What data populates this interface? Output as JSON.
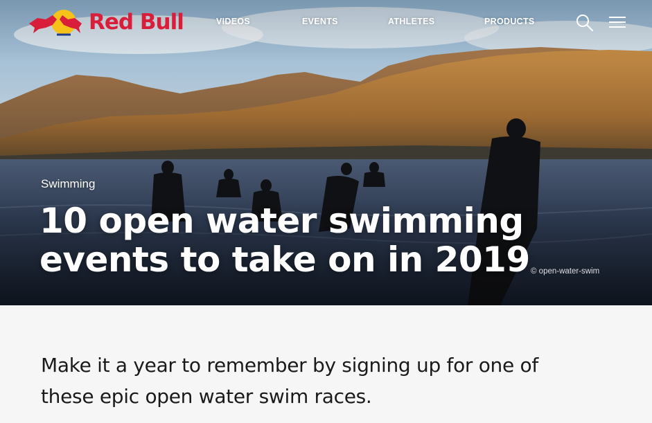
{
  "brand": {
    "name": "Red Bull",
    "color": "#d81e3a"
  },
  "nav": {
    "items": [
      {
        "label": "VIDEOS"
      },
      {
        "label": "EVENTS"
      },
      {
        "label": "ATHLETES"
      },
      {
        "label": "PRODUCTS"
      }
    ],
    "search_icon": "search-icon",
    "menu_icon": "hamburger-menu-icon"
  },
  "hero": {
    "category": "Swimming",
    "headline": "10 open water swimming events to take on in 2019",
    "credit": "© open-water-swim"
  },
  "intro": {
    "text": "Make it a year to remember by signing up for one of these epic open water swim races."
  }
}
